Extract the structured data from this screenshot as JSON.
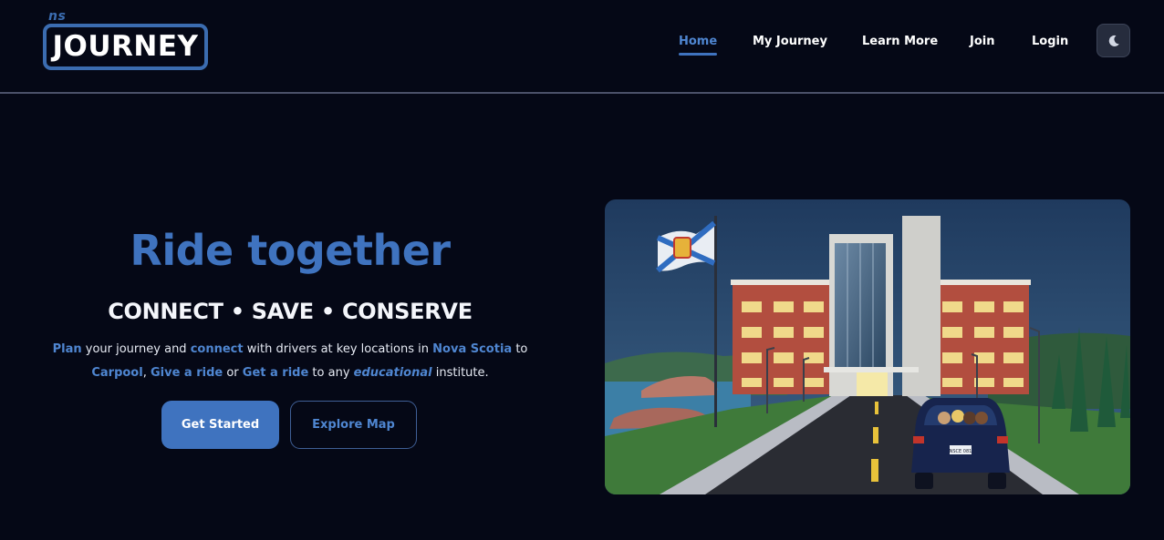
{
  "logo": {
    "small": "ns",
    "main": "JOURNEY"
  },
  "nav": {
    "items": [
      {
        "label": "Home",
        "active": true
      },
      {
        "label": "My Journey",
        "active": false
      },
      {
        "label": "Learn More",
        "active": false
      },
      {
        "label": "Join",
        "active": false
      },
      {
        "label": "Login",
        "active": false
      }
    ],
    "theme_toggle_icon": "moon-icon"
  },
  "hero": {
    "title": "Ride together",
    "subtitle": "CONNECT • SAVE • CONSERVE",
    "paragraph": {
      "plan": "Plan",
      "t1": " your journey and ",
      "connect": "connect",
      "t2": " with drivers at key locations in ",
      "nova_scotia": "Nova Scotia",
      "t3": " to",
      "carpool": "Carpool",
      "t4": ", ",
      "give_ride": "Give a ride",
      "t5": " or ",
      "get_ride": "Get a ride",
      "t6": " to any ",
      "educational": "educational",
      "t7": " institute."
    },
    "primary_button": "Get Started",
    "secondary_button": "Explore Map"
  },
  "illustration": {
    "description_icon": "campus-illustration",
    "license_plate": "NSCE 081"
  },
  "colors": {
    "background": "#050816",
    "accent": "#3f73bf",
    "accent_text": "#4f86d1",
    "divider": "#4b5169"
  }
}
